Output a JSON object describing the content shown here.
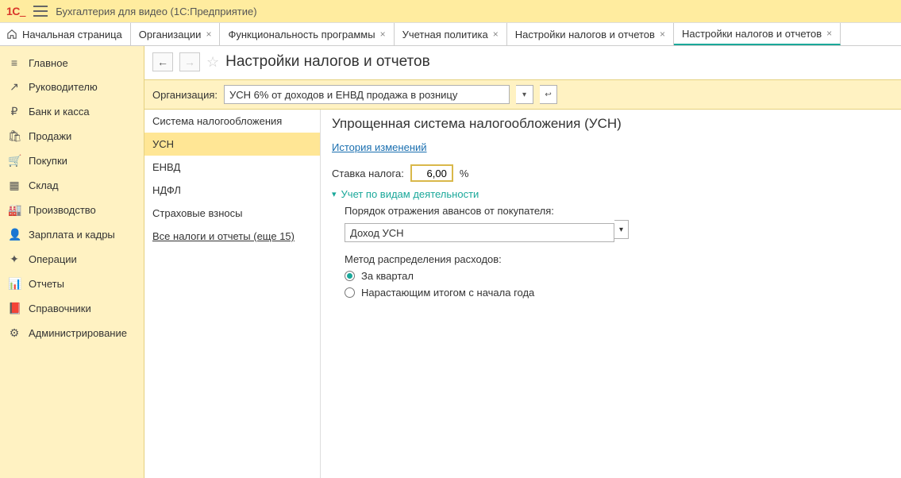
{
  "titlebar": {
    "app_title": "Бухгалтерия для видео  (1С:Предприятие)"
  },
  "tabs": [
    {
      "label": "Начальная страница",
      "closable": false,
      "home": true
    },
    {
      "label": "Организации",
      "closable": true
    },
    {
      "label": "Функциональность программы",
      "closable": true
    },
    {
      "label": "Учетная политика",
      "closable": true
    },
    {
      "label": "Настройки налогов и отчетов",
      "closable": true
    },
    {
      "label": "Настройки налогов и отчетов",
      "closable": true,
      "active": true
    }
  ],
  "sidebar": [
    {
      "icon": "≡",
      "label": "Главное"
    },
    {
      "icon": "↗",
      "label": "Руководителю"
    },
    {
      "icon": "₽",
      "label": "Банк и касса"
    },
    {
      "icon": "🛍",
      "label": "Продажи"
    },
    {
      "icon": "🛒",
      "label": "Покупки"
    },
    {
      "icon": "▦",
      "label": "Склад"
    },
    {
      "icon": "🏭",
      "label": "Производство"
    },
    {
      "icon": "👤",
      "label": "Зарплата и кадры"
    },
    {
      "icon": "✦",
      "label": "Операции"
    },
    {
      "icon": "📊",
      "label": "Отчеты"
    },
    {
      "icon": "📕",
      "label": "Справочники"
    },
    {
      "icon": "⚙",
      "label": "Администрирование"
    }
  ],
  "page": {
    "title": "Настройки налогов и отчетов"
  },
  "filter": {
    "label": "Организация:",
    "value": "УСН 6% от доходов и ЕНВД продажа в розницу"
  },
  "navlist": {
    "items": [
      "Система налогообложения",
      "УСН",
      "ЕНВД",
      "НДФЛ",
      "Страховые взносы"
    ],
    "selected": 1,
    "all_link": "Все налоги и отчеты (еще 15)"
  },
  "form": {
    "title": "Упрощенная система налогообложения (УСН)",
    "history_link": "История изменений",
    "tax_rate_label": "Ставка налога:",
    "tax_rate_value": "6,00",
    "tax_rate_suffix": "%",
    "group_header": "Учет по видам деятельности",
    "advance_label": "Порядок отражения авансов от покупателя:",
    "advance_value": "Доход УСН",
    "method_label": "Метод распределения расходов:",
    "radio1": "За квартал",
    "radio2": "Нарастающим итогом с начала года"
  }
}
